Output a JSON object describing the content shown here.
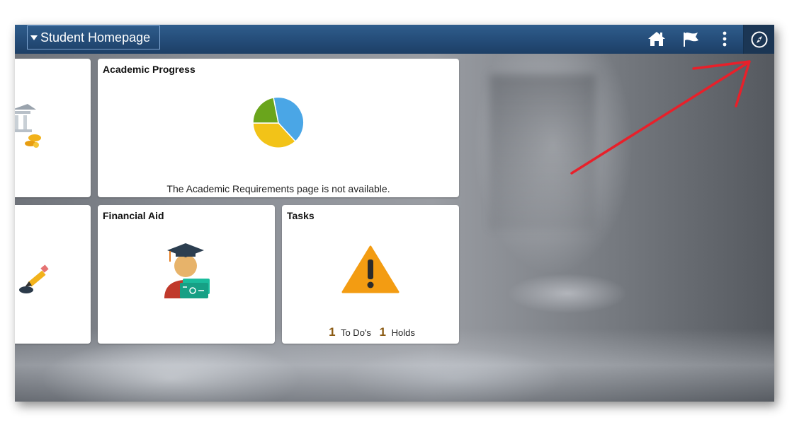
{
  "header": {
    "page_selector_label": "Student Homepage"
  },
  "icons": {
    "home": "home-icon",
    "notifications": "flag-icon",
    "actions": "kebab-menu-icon",
    "navbar": "compass-icon"
  },
  "tiles": {
    "academic_progress": {
      "title": "Academic Progress",
      "message": "The Academic Requirements page is not available."
    },
    "financial_aid": {
      "title": "Financial Aid"
    },
    "tasks": {
      "title": "Tasks",
      "todo_count": "1",
      "todo_label": "To Do's",
      "holds_count": "1",
      "holds_label": "Holds"
    }
  },
  "colors": {
    "header": "#244c78",
    "annotation_arrow": "#e8202a",
    "pie_blue": "#4aa6e6",
    "pie_yellow": "#f2c318",
    "pie_green": "#6aa51c",
    "warning": "#f39c12"
  }
}
